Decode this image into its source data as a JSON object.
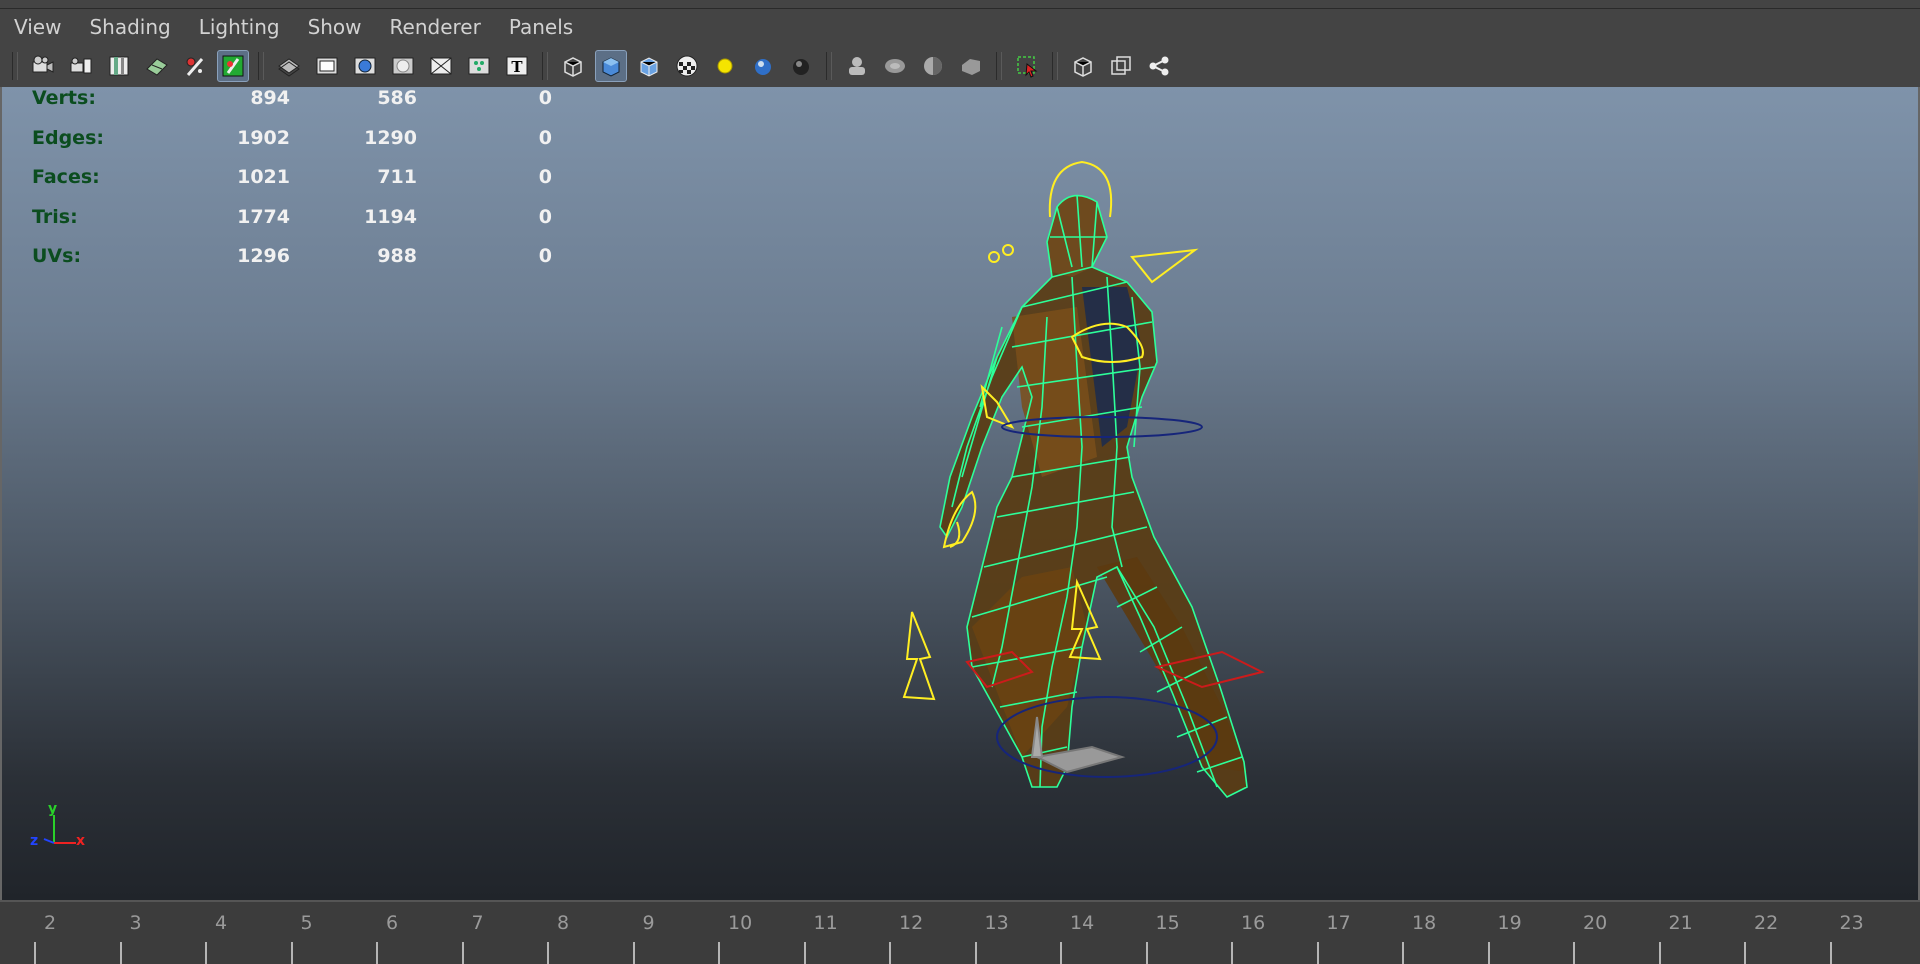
{
  "menu": [
    "View",
    "Shading",
    "Lighting",
    "Show",
    "Renderer",
    "Panels"
  ],
  "toolbar_groups": [
    [
      "camera-attributes-icon",
      "bookmark-camera-icon",
      "image-plane-icon",
      "2d-pan-zoom-icon",
      "grease-pencil-icon",
      "resolution-gate-icon"
    ],
    [
      "grid-icon",
      "film-gate-icon",
      "field-chart-icon",
      "safe-action-icon",
      "safe-title-icon",
      "xray-joints-icon",
      "hud-text-icon"
    ],
    [
      "wireframe-icon",
      "smooth-shade-icon",
      "wireframe-on-shaded-icon",
      "textured-icon",
      "default-lighting-icon",
      "all-lights-icon",
      "shadows-icon"
    ],
    [
      "isolate-select-icon",
      "xray-icon",
      "backface-icon",
      "ambient-occlusion-icon"
    ],
    [
      "select-camera-icon"
    ],
    [
      "front-view-icon",
      "side-view-icon",
      "hypergraph-icon"
    ]
  ],
  "hud": {
    "rows": [
      {
        "label": "Verts:",
        "v1": "894",
        "v2": "586",
        "v3": "0"
      },
      {
        "label": "Edges:",
        "v1": "1902",
        "v2": "1290",
        "v3": "0"
      },
      {
        "label": "Faces:",
        "v1": "1021",
        "v2": "711",
        "v3": "0"
      },
      {
        "label": "Tris:",
        "v1": "1774",
        "v2": "1194",
        "v3": "0"
      },
      {
        "label": "UVs:",
        "v1": "1296",
        "v2": "988",
        "v3": "0"
      }
    ]
  },
  "axis": {
    "y": "y",
    "x": "x",
    "z": "z"
  },
  "timeline": {
    "ticks": [
      "2",
      "3",
      "4",
      "5",
      "6",
      "7",
      "8",
      "9",
      "10",
      "11",
      "12",
      "13",
      "14",
      "15",
      "16",
      "17",
      "18",
      "19",
      "20",
      "21",
      "22",
      "23"
    ]
  },
  "colors": {
    "menu_bg": "#444444",
    "wire": "#2dff9a",
    "rig": "#ffee22",
    "hud_label": "#0b4d1f"
  }
}
